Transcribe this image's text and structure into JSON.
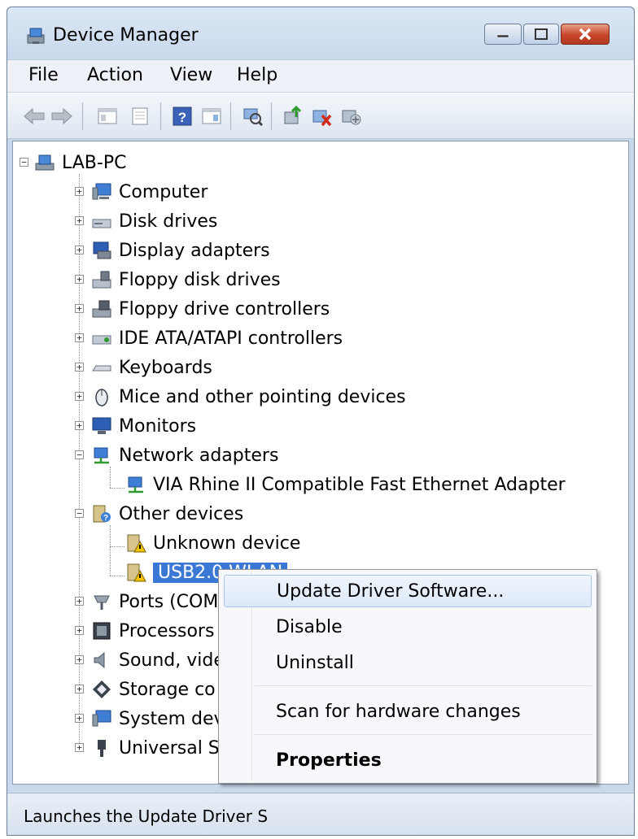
{
  "window": {
    "title": "Device Manager",
    "minimize_icon": "minimize-icon",
    "maximize_icon": "maximize-icon",
    "close_icon": "close-icon"
  },
  "menubar": {
    "items": [
      "File",
      "Action",
      "View",
      "Help"
    ]
  },
  "toolbar": {
    "buttons": [
      "back-arrow-icon",
      "forward-arrow-icon",
      "show-hide-console-tree-icon",
      "properties-icon",
      "help-icon",
      "action-pane-icon",
      "scan-hardware-icon",
      "update-driver-icon",
      "uninstall-icon",
      "enable-device-icon"
    ]
  },
  "tree": {
    "root": "LAB-PC",
    "categories": [
      {
        "label": "Computer",
        "icon": "computer-icon"
      },
      {
        "label": "Disk drives",
        "icon": "disk-drive-icon"
      },
      {
        "label": "Display adapters",
        "icon": "display-adapter-icon"
      },
      {
        "label": "Floppy disk drives",
        "icon": "floppy-disk-icon"
      },
      {
        "label": "Floppy drive controllers",
        "icon": "floppy-controller-icon"
      },
      {
        "label": "IDE ATA/ATAPI controllers",
        "icon": "ide-controller-icon"
      },
      {
        "label": "Keyboards",
        "icon": "keyboard-icon"
      },
      {
        "label": "Mice and other pointing devices",
        "icon": "mouse-icon"
      },
      {
        "label": "Monitors",
        "icon": "monitor-icon"
      },
      {
        "label": "Network adapters",
        "icon": "network-adapter-icon"
      },
      {
        "label": "VIA Rhine II Compatible Fast Ethernet Adapter",
        "icon": "network-adapter-icon"
      },
      {
        "label": "Other devices",
        "icon": "unknown-device-icon"
      },
      {
        "label": "Unknown device",
        "icon": "warning-device-icon"
      },
      {
        "label": "USB2.0 WLAN",
        "icon": "warning-device-icon"
      },
      {
        "label": "Ports (COM",
        "icon": "ports-icon"
      },
      {
        "label": "Processors",
        "icon": "processor-icon"
      },
      {
        "label": "Sound, vide",
        "icon": "sound-icon"
      },
      {
        "label": "Storage co",
        "icon": "storage-controller-icon"
      },
      {
        "label": "System dev",
        "icon": "system-device-icon"
      },
      {
        "label": "Universal S",
        "icon": "usb-icon"
      }
    ]
  },
  "context_menu": {
    "items": [
      "Update Driver Software...",
      "Disable",
      "Uninstall",
      "Scan for hardware changes",
      "Properties"
    ]
  },
  "status": {
    "text": "Launches the Update Driver S"
  }
}
